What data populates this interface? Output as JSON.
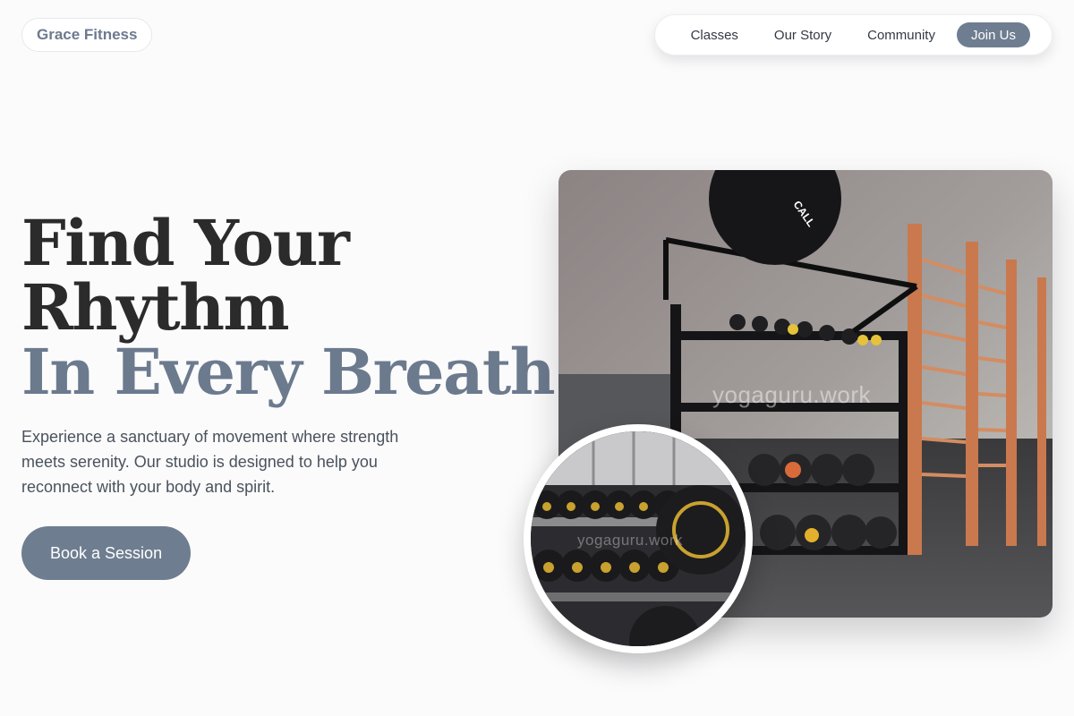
{
  "brand": {
    "name": "Grace Fitness"
  },
  "nav": {
    "items": [
      "Classes",
      "Our Story",
      "Community"
    ],
    "cta_label": "Join Us"
  },
  "hero": {
    "headline_line1": "Find Your",
    "headline_line2": "Rhythm",
    "headline_accent": "In Every Breath.",
    "description": "Experience a sanctuary of movement where strength meets serenity. Our studio is designed to help you reconnect with your body and spirit.",
    "button_label": "Book a Session",
    "watermark": "yogaguru.work",
    "ball_label": "CALL"
  },
  "colors": {
    "accent": "#6c7a8e",
    "button": "#6f7d90",
    "text": "#2b2b2b",
    "background": "#fbfbfc"
  }
}
